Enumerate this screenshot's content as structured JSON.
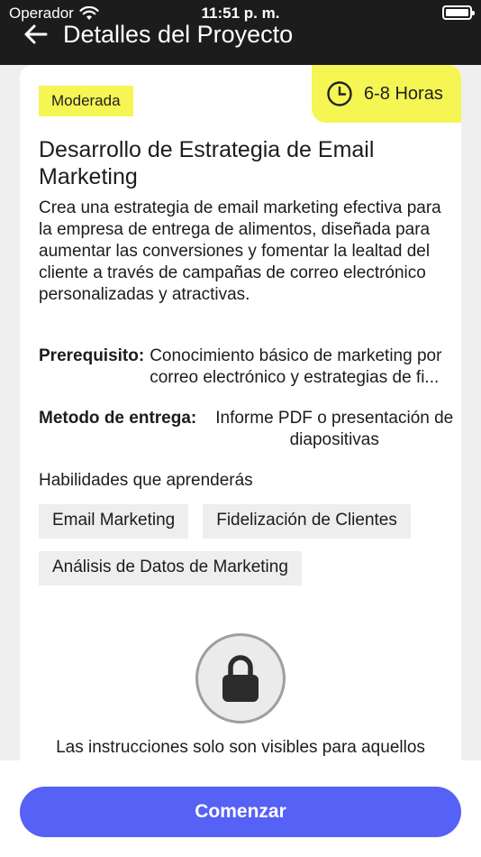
{
  "status_bar": {
    "carrier": "Operador",
    "time": "11:51 p. m."
  },
  "header": {
    "title": "Detalles del Proyecto"
  },
  "project": {
    "difficulty": "Moderada",
    "duration": "6-8 Horas",
    "title": "Desarrollo de Estrategia de Email Marketing",
    "description": "Crea una estrategia de email marketing efectiva para la empresa de entrega de alimentos, diseñada para aumentar las conversiones y fomentar la lealtad del cliente a través de campañas de correo electrónico personalizadas y atractivas.",
    "prerequisite_label": "Prerequisito:",
    "prerequisite_value": "Conocimiento básico de marketing por\ncorreo electrónico y estrategias de fi...",
    "delivery_label": "Metodo de entrega:",
    "delivery_value": "Informe PDF o presentación de diapositivas",
    "skills_heading": "Habilidades que aprenderás",
    "skills": [
      "Email Marketing",
      "Fidelización de Clientes",
      "Análisis de Datos de Marketing"
    ],
    "locked_notice": "Las instrucciones solo son visibles para aquellos"
  },
  "actions": {
    "start_label": "Comenzar"
  },
  "colors": {
    "accent": "#5661f5",
    "highlight": "#f5f553",
    "header_bg": "#1c1c1c"
  },
  "icons": {
    "back": "arrow-left-icon",
    "clock": "clock-icon",
    "lock": "lock-icon",
    "wifi": "wifi-icon",
    "battery": "battery-icon"
  }
}
